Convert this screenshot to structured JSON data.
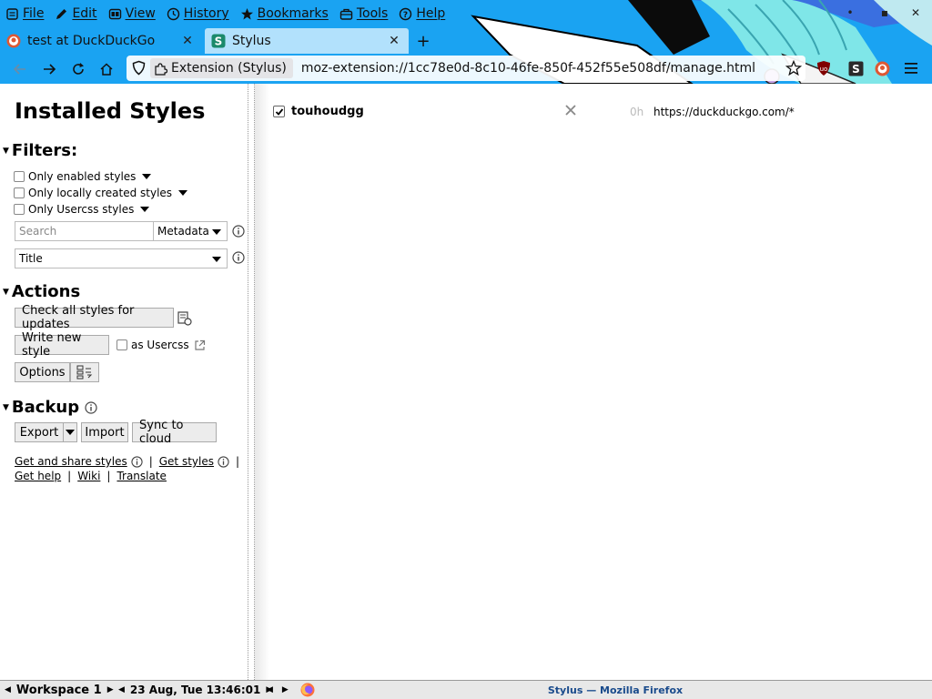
{
  "menubar": {
    "items": [
      {
        "label": "File",
        "icon": "file-icon"
      },
      {
        "label": "Edit",
        "icon": "pencil-icon"
      },
      {
        "label": "View",
        "icon": "view-icon"
      },
      {
        "label": "History",
        "icon": "clock-icon"
      },
      {
        "label": "Bookmarks",
        "icon": "star-icon"
      },
      {
        "label": "Tools",
        "icon": "toolbox-icon"
      },
      {
        "label": "Help",
        "icon": "help-icon"
      }
    ]
  },
  "window_controls": {
    "minimize": "•",
    "maximize": "▪",
    "close": "✕"
  },
  "tabs": [
    {
      "label": "test at DuckDuckGo",
      "icon": "duckduckgo-icon",
      "active": false
    },
    {
      "label": "Stylus",
      "icon": "stylus-icon",
      "active": true
    }
  ],
  "new_tab": "+",
  "urlbar": {
    "identity_label": "Extension (Stylus)",
    "url": "moz-extension://1cc78e0d-8c10-46fe-850f-452f55e508df/manage.html"
  },
  "sidebar": {
    "title": "Installed Styles",
    "filters_heading": "Filters:",
    "filters": [
      "Only enabled styles",
      "Only locally created styles",
      "Only Usercss styles"
    ],
    "search_placeholder": "Search",
    "search_mode": "Metadata",
    "sort_by": "Title",
    "actions_heading": "Actions",
    "check_updates": "Check all styles for updates",
    "write_new": "Write new style",
    "as_usercss": "as Usercss",
    "options": "Options",
    "backup_heading": "Backup",
    "export": "Export",
    "import": "Import",
    "sync": "Sync to cloud",
    "links": {
      "get_and_share": "Get and share styles",
      "get_styles": "Get styles",
      "get_help": "Get help",
      "wiki": "Wiki",
      "translate": "Translate",
      "sep": "|"
    }
  },
  "styles": [
    {
      "name": "touhoudgg",
      "enabled": true,
      "age": "0h",
      "applies_to": "https://duckduckgo.com/*"
    }
  ],
  "taskbar": {
    "workspace": "Workspace 1",
    "datetime": "23 Aug, Tue 13:46:01",
    "window_title": "Stylus — Mozilla Firefox"
  },
  "colors": {
    "chrome_bg": "#1aa3f2",
    "taskbar_title": "#1a4b8c"
  }
}
